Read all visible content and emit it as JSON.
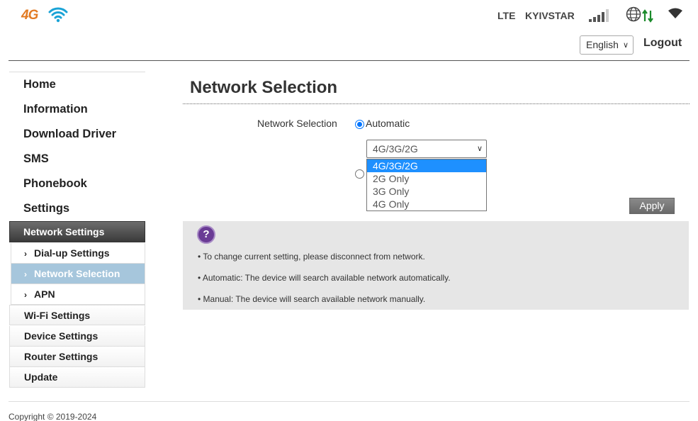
{
  "header": {
    "logo_text": "4G",
    "network_type": "LTE",
    "carrier": "KYIVSTAR",
    "signal_bars": 4,
    "signal_max": 5,
    "data_arrows_color": "#1a8a2a",
    "language": "English",
    "logout_label": "Logout"
  },
  "sidebar": {
    "main_items": [
      "Home",
      "Information",
      "Download Driver",
      "SMS",
      "Phonebook",
      "Settings"
    ],
    "section_header": "Network Settings",
    "sub_items": [
      {
        "label": "Dial-up Settings",
        "active": false
      },
      {
        "label": "Network Selection",
        "active": true
      },
      {
        "label": "APN",
        "active": false
      }
    ],
    "categories": [
      "Wi-Fi Settings",
      "Device Settings",
      "Router Settings",
      "Update"
    ]
  },
  "main": {
    "title": "Network Selection",
    "field_label": "Network Selection",
    "automatic_label": "Automatic",
    "automatic_checked": true,
    "manual_checked": false,
    "mode_select": {
      "value": "4G/3G/2G",
      "options": [
        "4G/3G/2G",
        "2G Only",
        "3G Only",
        "4G Only"
      ],
      "highlighted": "4G/3G/2G"
    },
    "apply_label": "Apply"
  },
  "help": {
    "icon": "question-icon",
    "lines": [
      "• To change current setting, please disconnect from network.",
      "• Automatic: The device will search available network automatically.",
      "• Manual: The device will search available network manually."
    ]
  },
  "footer": {
    "copyright": "Copyright © 2019-2024"
  },
  "colors": {
    "accent": "#e27a22",
    "wifi_logo": "#1aa3d6",
    "active_nav": "#a6c6dc",
    "help_purple": "#6a3b95",
    "dropdown_highlight": "#1e90ff"
  }
}
